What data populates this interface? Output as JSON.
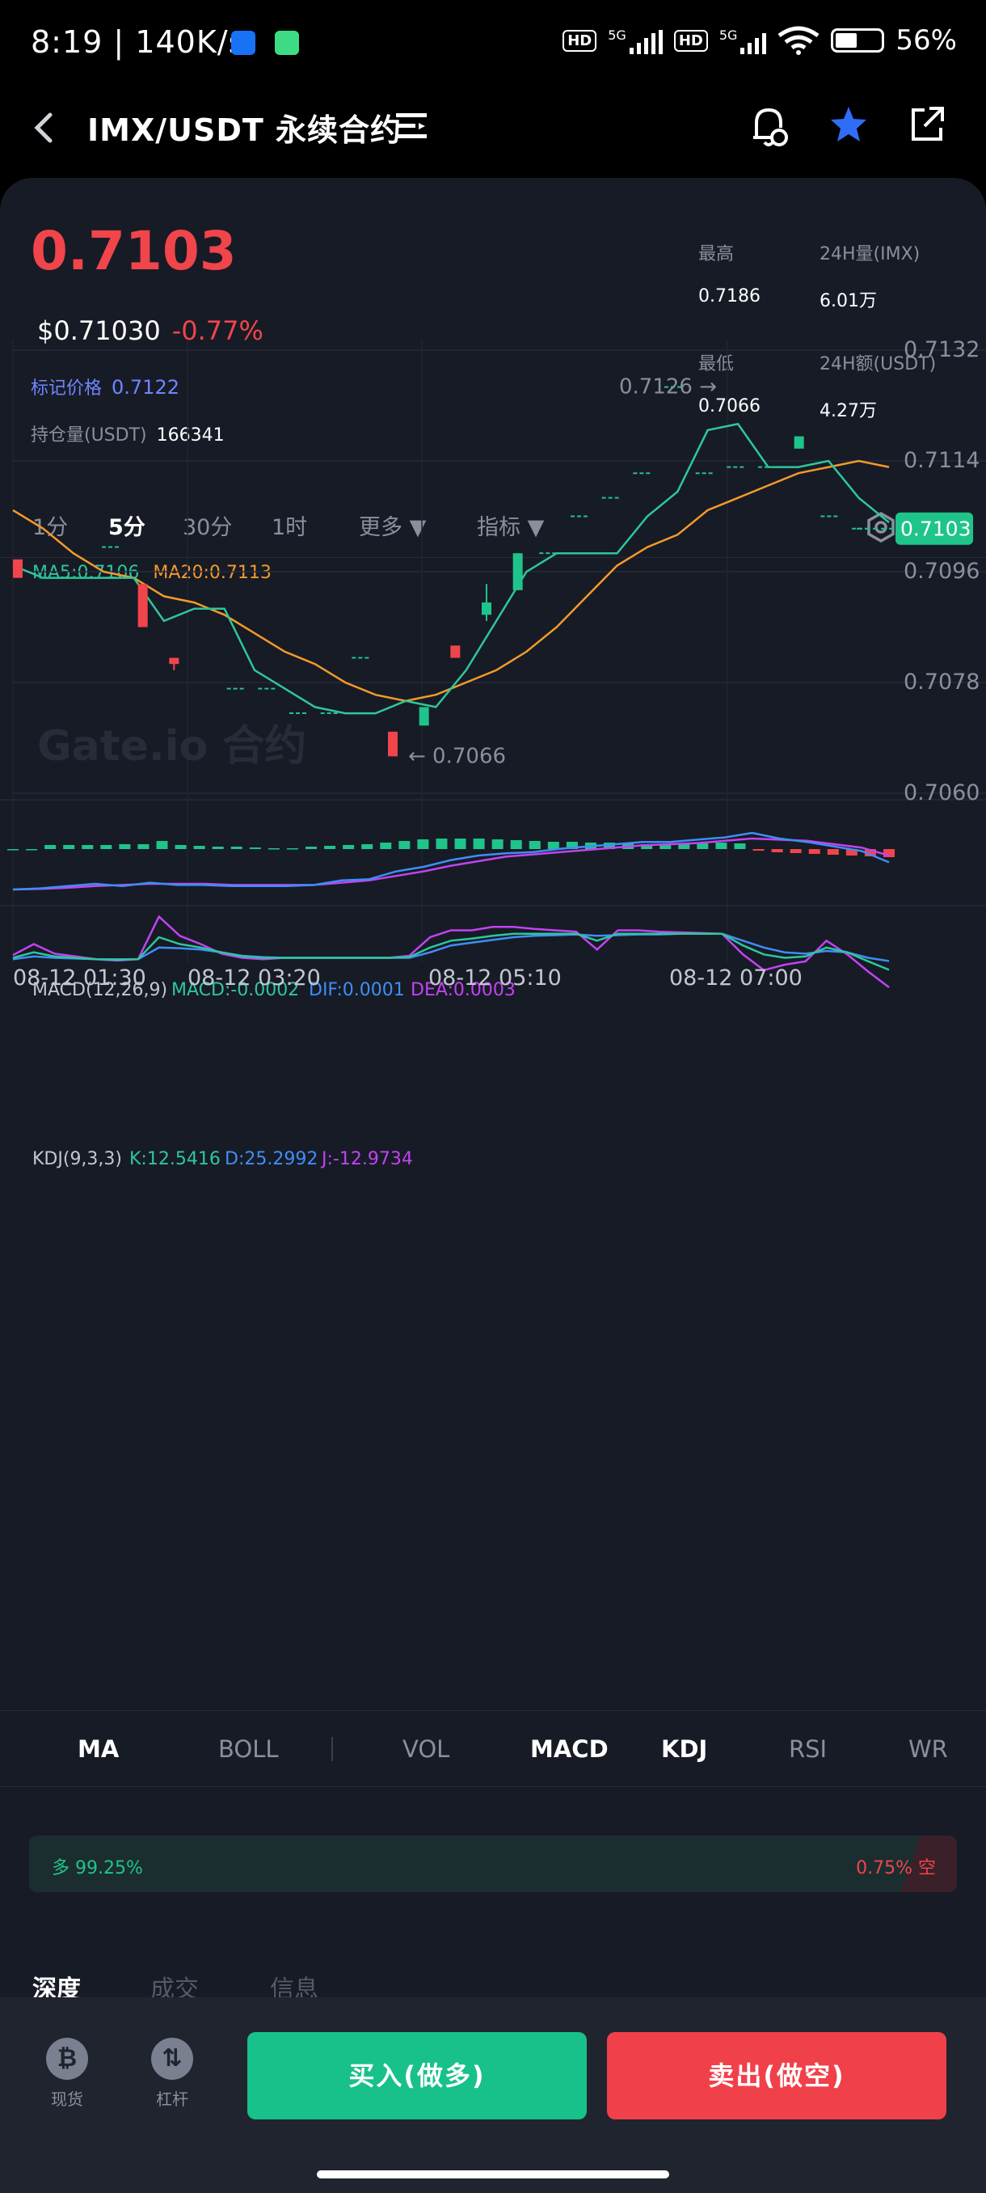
{
  "status_bar": {
    "time": "8:19",
    "speed": "140K/s",
    "net1": "5G",
    "net2": "5G",
    "battery": "56%"
  },
  "header": {
    "title": "IMX/USDT 永续合约"
  },
  "ticker": {
    "price": "0.7103",
    "usd_price": "$0.71030",
    "change": "-0.77%",
    "mark_label": "标记价格",
    "mark_value": "0.7122",
    "oi_label": "持仓量(USDT)",
    "oi_value": "166341",
    "high_label": "最高",
    "high_value": "0.7186",
    "low_label": "最低",
    "low_value": "0.7066",
    "vol_label": "24H量(IMX)",
    "vol_value": "6.01万",
    "amount_label": "24H额(USDT)",
    "amount_value": "4.27万"
  },
  "interval_tabs": [
    "1分",
    "5分",
    "30分",
    "1时",
    "更多",
    "指标"
  ],
  "active_interval": "5分",
  "ma_legend": {
    "ma5": "MA5:0.7106",
    "ma20": "MA20:0.7113"
  },
  "macd_legend": {
    "name": "MACD(12,26,9)",
    "macd": "MACD:-0.0002",
    "dif": "DIF:0.0001",
    "dea": "DEA:0.0003"
  },
  "kdj_legend": {
    "name": "KDJ(9,3,3)",
    "k": "K:12.5416",
    "d": "D:25.2992",
    "j": "J:-12.9734"
  },
  "indicator_tabs": [
    "MA",
    "BOLL",
    "VOL",
    "MACD",
    "KDJ",
    "RSI",
    "WR"
  ],
  "long_short": {
    "long": "多 99.25%",
    "short": "0.75% 空",
    "long_pct": 99.25
  },
  "detail_tabs": [
    "深度",
    "成交",
    "信息"
  ],
  "bottom": {
    "spot": "现货",
    "margin": "杠杆",
    "buy": "买入(做多)",
    "sell": "卖出(做空)"
  },
  "watermark": "Gate.io 合约",
  "colors": {
    "up": "#1fc48a",
    "down": "#f0454a",
    "ma5": "#2ec79a",
    "ma20": "#f39a2b",
    "dif": "#3f8ef5",
    "dea": "#c243f2",
    "bg": "#171b26",
    "accent": "#3b82f6"
  },
  "chart_data": {
    "type": "candlestick",
    "y_ticks": [
      "0.7132",
      "0.7114",
      "0.7096",
      "0.7078",
      "0.7060"
    ],
    "ylim": [
      0.706,
      0.7132
    ],
    "x_ticks": [
      "08-12 01:30",
      "08-12 03:20",
      "08-12 05:10",
      "08-12 07:00"
    ],
    "last_price_tag": "0.7103",
    "max_annotation": "0.7126 →",
    "min_annotation": "← 0.7066",
    "candles": [
      {
        "o": 0.7098,
        "c": 0.7095,
        "h": 0.7098,
        "l": 0.7095
      },
      {
        "o": 0.7095,
        "c": 0.7095,
        "h": 0.7095,
        "l": 0.7095
      },
      {
        "o": 0.7095,
        "c": 0.7095,
        "h": 0.7095,
        "l": 0.7095
      },
      {
        "o": 0.71,
        "c": 0.71,
        "h": 0.71,
        "l": 0.71
      },
      {
        "o": 0.7094,
        "c": 0.7087,
        "h": 0.7094,
        "l": 0.7087
      },
      {
        "o": 0.7082,
        "c": 0.7081,
        "h": 0.7082,
        "l": 0.708
      },
      {
        "o": 0.709,
        "c": 0.709,
        "h": 0.709,
        "l": 0.709
      },
      {
        "o": 0.7077,
        "c": 0.7077,
        "h": 0.7077,
        "l": 0.7077
      },
      {
        "o": 0.7077,
        "c": 0.7077,
        "h": 0.7077,
        "l": 0.7077
      },
      {
        "o": 0.7073,
        "c": 0.7073,
        "h": 0.7073,
        "l": 0.7073
      },
      {
        "o": 0.7073,
        "c": 0.7073,
        "h": 0.7073,
        "l": 0.7073
      },
      {
        "o": 0.7082,
        "c": 0.7082,
        "h": 0.7082,
        "l": 0.7082
      },
      {
        "o": 0.707,
        "c": 0.7066,
        "h": 0.707,
        "l": 0.7066
      },
      {
        "o": 0.7071,
        "c": 0.7074,
        "h": 0.7074,
        "l": 0.7071
      },
      {
        "o": 0.7084,
        "c": 0.7082,
        "h": 0.7084,
        "l": 0.7082
      },
      {
        "o": 0.7089,
        "c": 0.7091,
        "h": 0.7094,
        "l": 0.7088
      },
      {
        "o": 0.7093,
        "c": 0.7099,
        "h": 0.7099,
        "l": 0.7093
      },
      {
        "o": 0.7099,
        "c": 0.7099,
        "h": 0.7099,
        "l": 0.7099
      },
      {
        "o": 0.7105,
        "c": 0.7105,
        "h": 0.7105,
        "l": 0.7105
      },
      {
        "o": 0.7108,
        "c": 0.7108,
        "h": 0.7108,
        "l": 0.7108
      },
      {
        "o": 0.7112,
        "c": 0.7112,
        "h": 0.7112,
        "l": 0.7112
      },
      {
        "o": 0.7126,
        "c": 0.7126,
        "h": 0.7126,
        "l": 0.7126
      },
      {
        "o": 0.7112,
        "c": 0.7112,
        "h": 0.7112,
        "l": 0.7112
      },
      {
        "o": 0.7113,
        "c": 0.7113,
        "h": 0.7113,
        "l": 0.7113
      },
      {
        "o": 0.7113,
        "c": 0.7113,
        "h": 0.7113,
        "l": 0.7113
      },
      {
        "o": 0.7116,
        "c": 0.7118,
        "h": 0.7118,
        "l": 0.7116
      },
      {
        "o": 0.7105,
        "c": 0.7105,
        "h": 0.7105,
        "l": 0.7105
      },
      {
        "o": 0.7103,
        "c": 0.7103,
        "h": 0.7103,
        "l": 0.7103
      }
    ],
    "ma5": [
      0.7097,
      0.7095,
      0.7095,
      0.7095,
      0.7095,
      0.7088,
      0.709,
      0.709,
      0.708,
      0.7077,
      0.7074,
      0.7073,
      0.7073,
      0.7075,
      0.7074,
      0.708,
      0.7088,
      0.7096,
      0.7099,
      0.7099,
      0.7099,
      0.7105,
      0.7109,
      0.7119,
      0.712,
      0.7113,
      0.7113,
      0.7114,
      0.7108,
      0.7104
    ],
    "ma20": [
      0.7106,
      0.7103,
      0.7099,
      0.7096,
      0.7095,
      0.7092,
      0.7091,
      0.7089,
      0.7086,
      0.7083,
      0.7081,
      0.7078,
      0.7076,
      0.7075,
      0.7076,
      0.7078,
      0.708,
      0.7083,
      0.7087,
      0.7092,
      0.7097,
      0.71,
      0.7102,
      0.7106,
      0.7108,
      0.711,
      0.7112,
      0.7113,
      0.7114,
      0.7113
    ],
    "macd_hist": [
      0,
      0,
      0.5,
      0.5,
      0.5,
      0.5,
      0.6,
      0.6,
      1,
      0.5,
      0.4,
      0.3,
      0.3,
      0.2,
      0.1,
      0.1,
      0.3,
      0.4,
      0.5,
      0.6,
      0.8,
      1,
      1.2,
      1.3,
      1.3,
      1.3,
      1.2,
      1.1,
      1,
      0.9,
      0.9,
      0.8,
      0.8,
      0.7,
      0.6,
      0.5,
      0.6,
      0.7,
      0.8,
      0.7,
      -0.2,
      -0.4,
      -0.5,
      -0.6,
      -0.7,
      -0.8,
      -0.9,
      -1
    ],
    "dif": [
      0,
      0.1,
      0.3,
      0.5,
      0.3,
      0.6,
      0.4,
      0.4,
      0.3,
      0.3,
      0.3,
      0.4,
      0.8,
      0.9,
      1.6,
      2.0,
      2.6,
      3.0,
      3.2,
      3.3,
      3.6,
      3.8,
      4.0,
      4.2,
      4.2,
      4.4,
      4.6,
      5.0,
      4.5,
      4.2,
      3.8,
      3.4,
      2.4
    ],
    "dea": [
      0,
      0.05,
      0.15,
      0.3,
      0.4,
      0.5,
      0.5,
      0.5,
      0.4,
      0.4,
      0.4,
      0.4,
      0.6,
      0.8,
      1.2,
      1.6,
      2.1,
      2.5,
      2.9,
      3.1,
      3.3,
      3.5,
      3.7,
      3.9,
      4.0,
      4.1,
      4.3,
      4.5,
      4.4,
      4.3,
      4.0,
      3.7,
      3.0
    ],
    "k": [
      30,
      38,
      32,
      30,
      28,
      27,
      28,
      60,
      50,
      45,
      38,
      32,
      30,
      30,
      30,
      30,
      30,
      30,
      30,
      31,
      45,
      55,
      58,
      62,
      65,
      65,
      65,
      65,
      55,
      65,
      65,
      65,
      65,
      65,
      65,
      48,
      35,
      30,
      32,
      45,
      38,
      25,
      12.5
    ],
    "d": [
      28,
      32,
      30,
      29,
      28,
      28,
      28,
      45,
      44,
      42,
      38,
      33,
      31,
      30,
      30,
      30,
      30,
      30,
      30,
      30,
      38,
      48,
      52,
      56,
      60,
      62,
      63,
      64,
      62,
      63,
      64,
      64,
      65,
      65,
      65,
      55,
      45,
      38,
      36,
      40,
      38,
      30,
      25.3
    ],
    "j": [
      34,
      50,
      36,
      32,
      28,
      26,
      28,
      90,
      62,
      50,
      36,
      30,
      28,
      30,
      30,
      30,
      30,
      30,
      30,
      33,
      60,
      70,
      70,
      75,
      75,
      72,
      70,
      68,
      42,
      70,
      70,
      68,
      67,
      66,
      65,
      35,
      12,
      20,
      25,
      55,
      35,
      10,
      -12.97
    ]
  }
}
